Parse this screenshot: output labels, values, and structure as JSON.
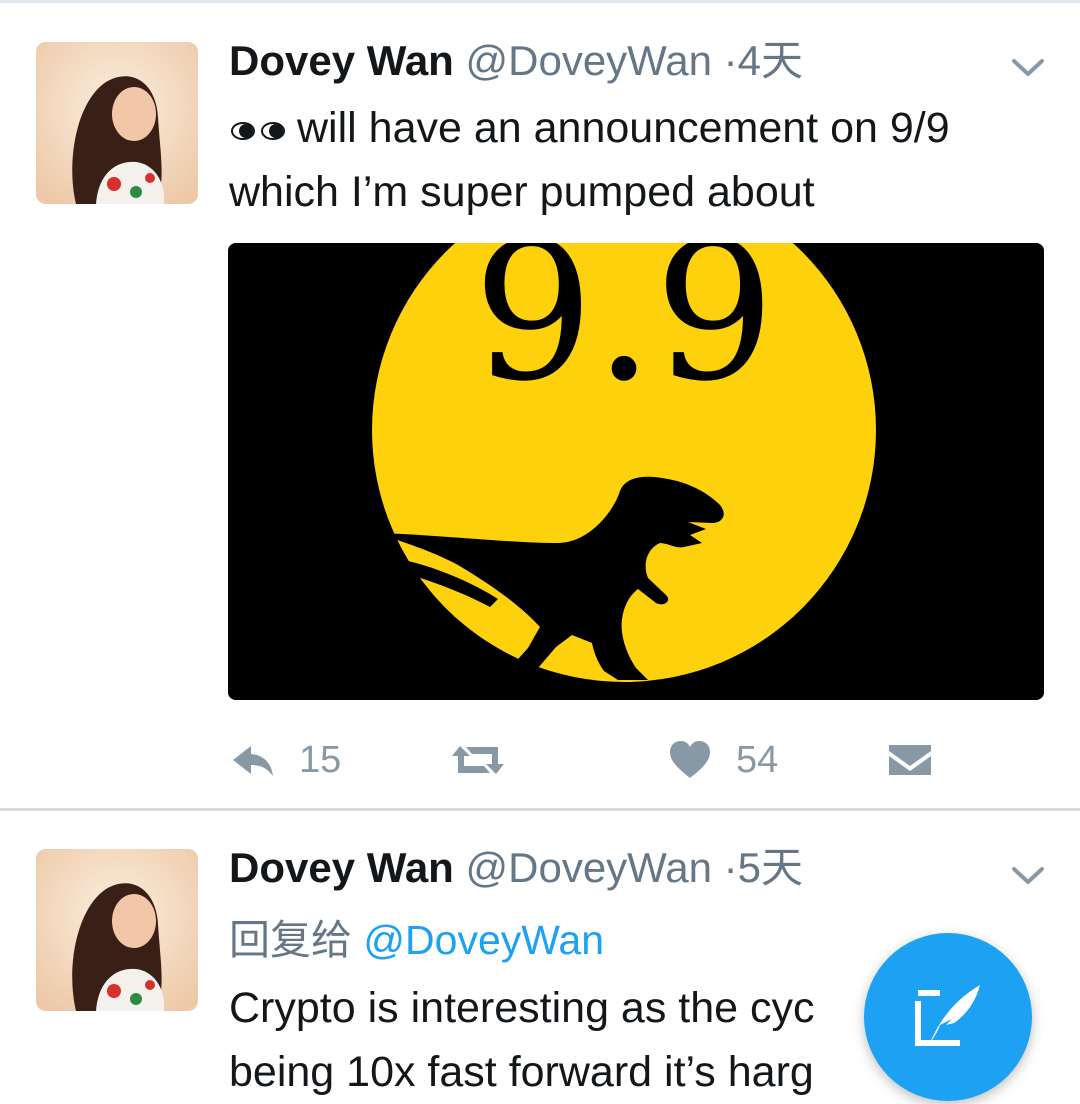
{
  "colors": {
    "accent": "#1da1f2",
    "secondary_text": "#657786",
    "action_gray": "#8899a6",
    "divider": "#e1e8ed",
    "media_yellow": "#fdd10b"
  },
  "tweets": [
    {
      "author": {
        "name": "Dovey Wan",
        "handle": "@DoveyWan"
      },
      "separator": "·",
      "time": "4天",
      "text_emoji": "eyes-emoji",
      "text": "will have an announcement on 9/9 which I’m super pumped about",
      "media": {
        "kind": "image",
        "text": "9.9",
        "depicts": "dinosaur silhouette in front of yellow circle"
      },
      "actions": {
        "reply_count": "15",
        "retweet_count": "",
        "like_count": "54"
      }
    },
    {
      "author": {
        "name": "Dovey Wan",
        "handle": "@DoveyWan"
      },
      "separator": "·",
      "time": "5天",
      "reply_label": "回复给",
      "reply_handle": "@DoveyWan",
      "text_line1": "Crypto is interesting as the cyc",
      "text_line2": "being 10x fast forward it’s harg"
    }
  ],
  "icons": {
    "caret": "chevron-down-icon",
    "reply": "reply-icon",
    "retweet": "retweet-icon",
    "like": "heart-icon",
    "dm": "direct-message-icon",
    "compose": "compose-tweet-icon"
  }
}
